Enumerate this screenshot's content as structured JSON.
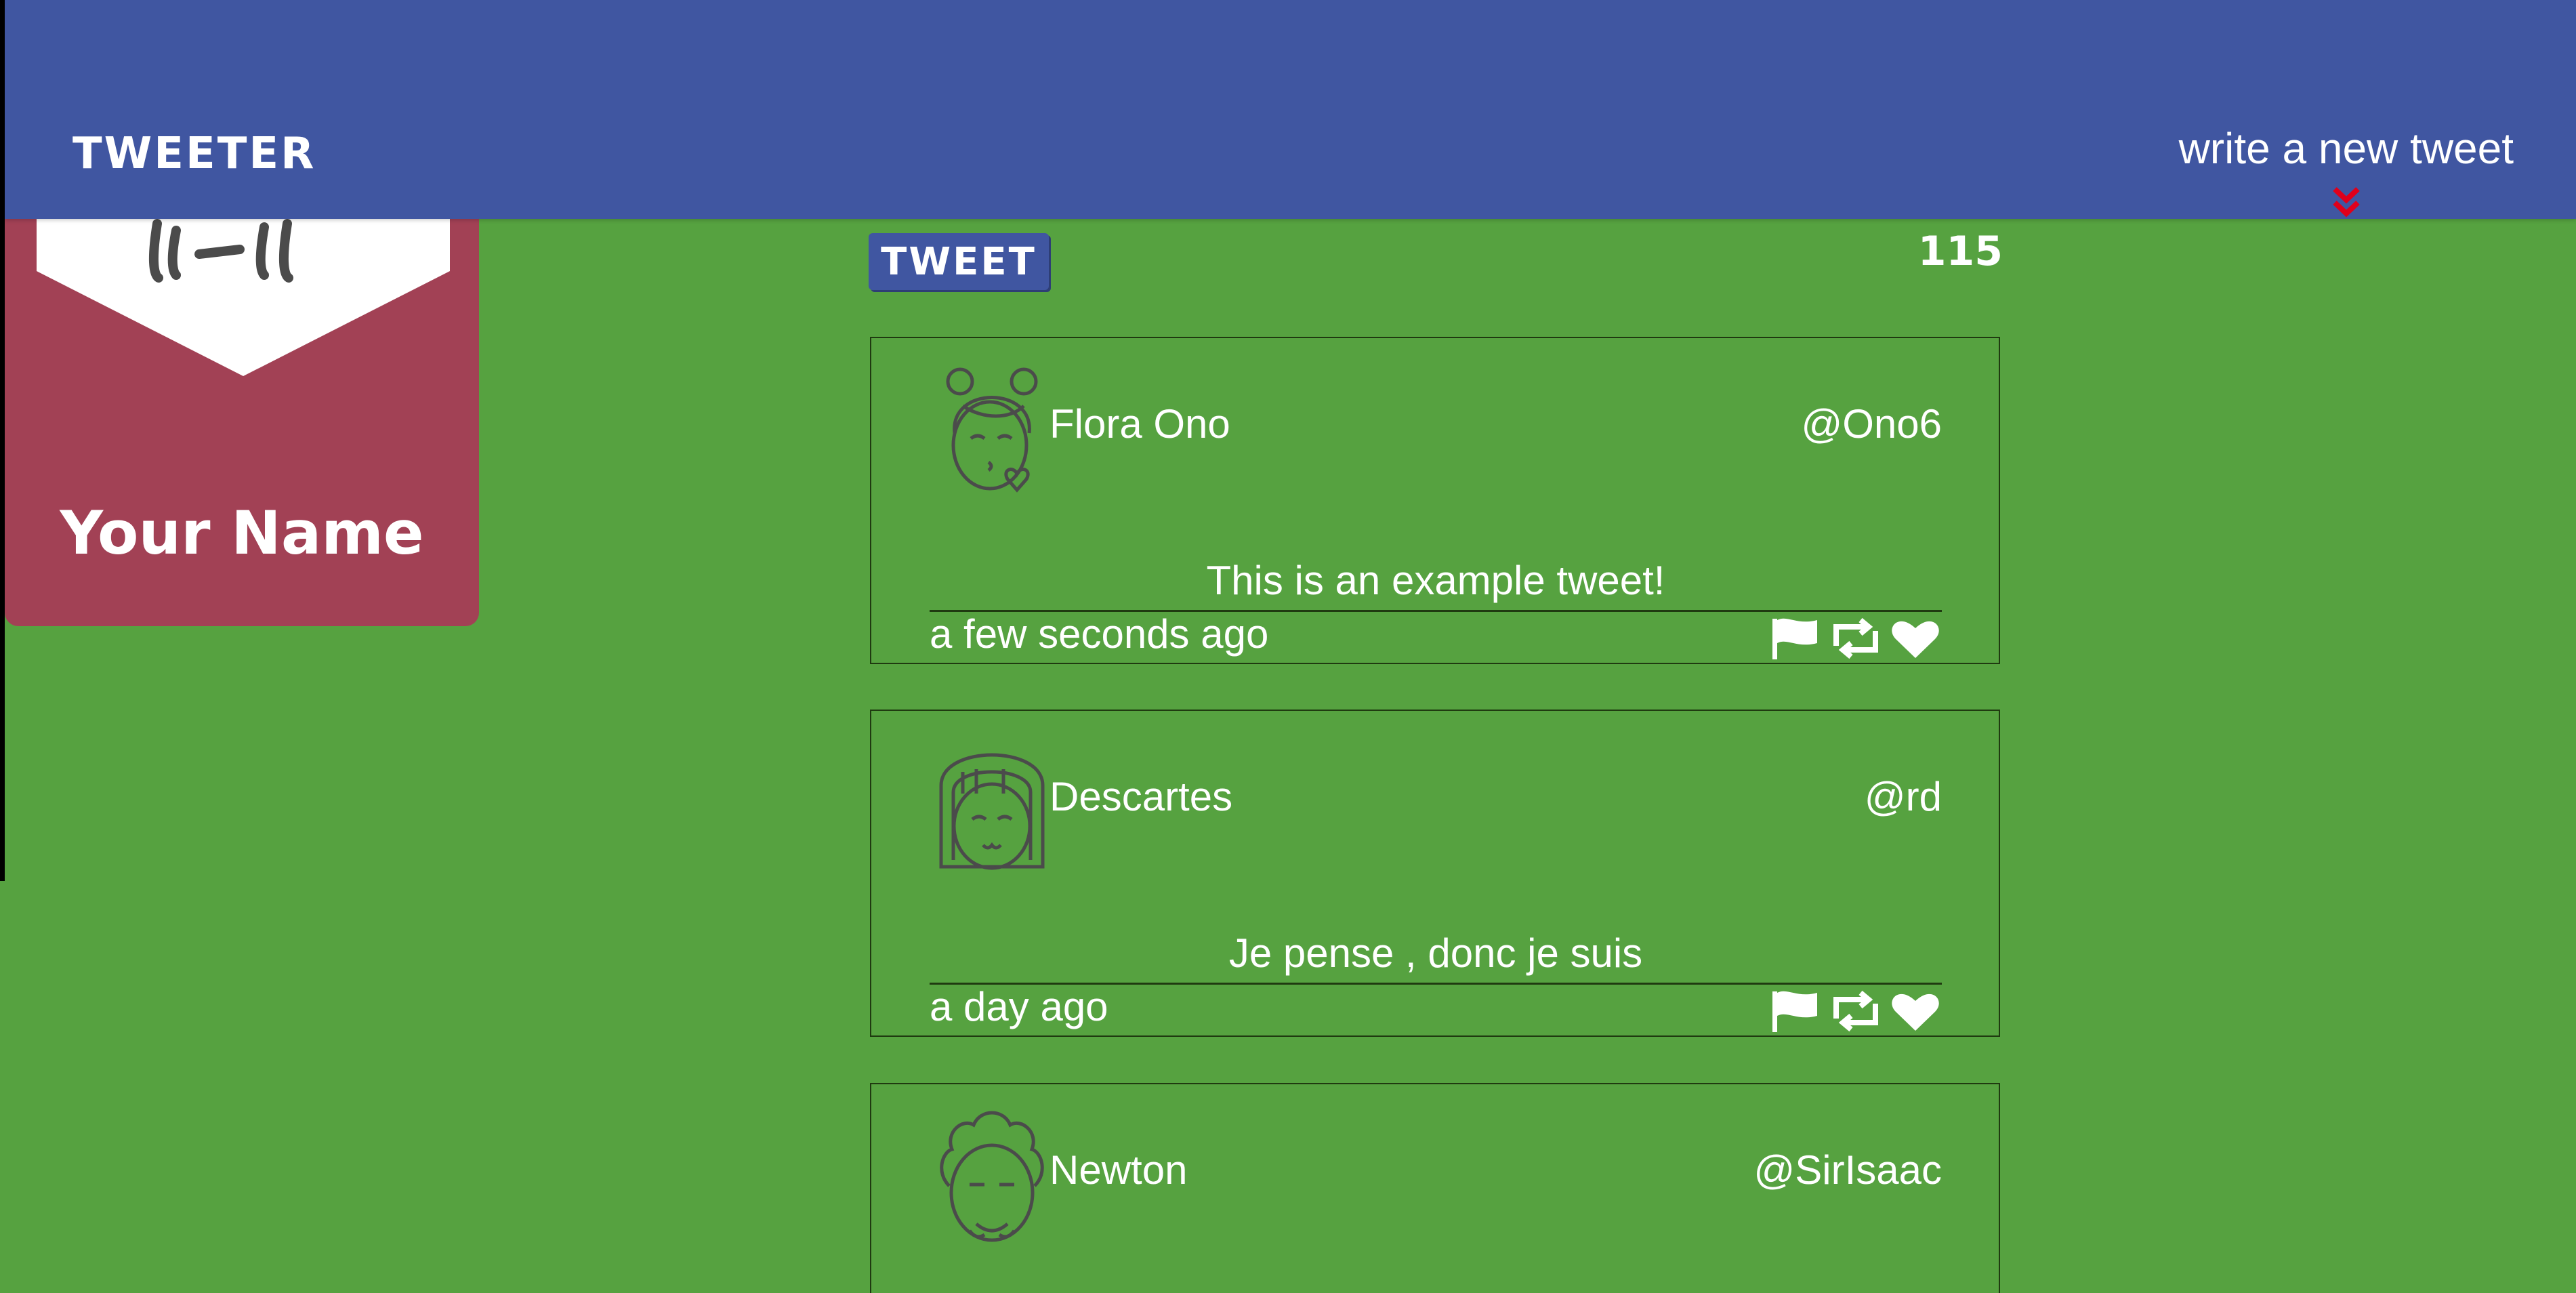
{
  "header": {
    "brand": "TWEETER",
    "compose_link": "write a new tweet",
    "compose_icon": "double-chevron-down-icon",
    "compose_icon_color": "#e0001b"
  },
  "profile": {
    "avatar_icon": "user-avatar-icon",
    "name": "Your Name"
  },
  "composer": {
    "submit_label": "TWEET",
    "char_counter": "115"
  },
  "tweets": [
    {
      "avatar_icon": "girl-kiss-avatar-icon",
      "name": "Flora Ono",
      "handle": "@Ono6",
      "text": "This is an example tweet!",
      "time": "a few seconds ago",
      "actions": [
        "flag-icon",
        "retweet-icon",
        "heart-icon"
      ]
    },
    {
      "avatar_icon": "girl-bangs-avatar-icon",
      "name": "Descartes",
      "handle": "@rd",
      "text": "Je pense , donc je suis",
      "time": "a day ago",
      "actions": [
        "flag-icon",
        "retweet-icon",
        "heart-icon"
      ]
    },
    {
      "avatar_icon": "curly-hair-avatar-icon",
      "name": "Newton",
      "handle": "@SirIsaac",
      "text": "",
      "time": "",
      "actions": []
    }
  ],
  "colors": {
    "background": "#56a240",
    "header": "#4056a1",
    "profile_card": "#a24155",
    "text": "#ffffff",
    "outline": "#1f3a10"
  }
}
